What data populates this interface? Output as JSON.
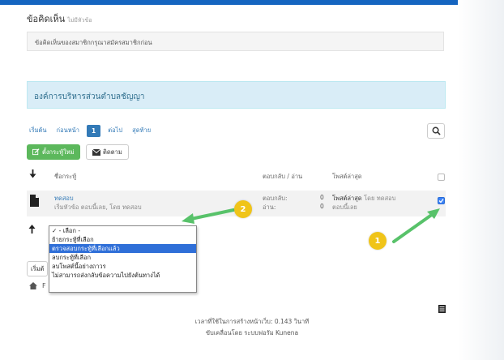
{
  "section": {
    "title": "ข้อคิดเห็น",
    "subtitle": "ไม่มีหัวข้อ"
  },
  "comment": {
    "text": "ข้อคิดเห็นของสมาชิกกรุณาสมัครสมาชิกก่อน"
  },
  "category": {
    "title": "องค์การบริหารส่วนตำบลชัญญา"
  },
  "pager": {
    "first": "เริ่มต้น",
    "prev": "ก่อนหน้า",
    "current": "1",
    "next": "ต่อไป",
    "last": "สุดท้าย"
  },
  "toolbar": {
    "new_topic": "ตั้งกระทู้ใหม่",
    "subscribe": "ติดตาม"
  },
  "table": {
    "col_subject": "ชื่อกระทู้",
    "col_replies": "ตอบกลับ / อ่าน",
    "col_last": "โพสต์ล่าสุด",
    "row": {
      "title": "ทดสอบ",
      "meta": "เริ่มหัวข้อ ตอบนี้เลย, โดย ทดสอบ",
      "replies_label": "ตอบกลับ:",
      "replies": "0",
      "views_label": "อ่าน:",
      "views": "0",
      "last_post_prefix": "โพสต์ล่าสุด",
      "last_post_by": "โดย ทดสอบ",
      "last_post_time": "ตอบนี้เลย",
      "checked": true
    }
  },
  "dropdown": {
    "options": [
      "✓ - เลือก -",
      "ย้ายกระทู้ที่เลือก",
      "ตรวจสอบกระทู้ที่เลือกแล้ว",
      "ลบกระทู้ที่เลือก",
      "ลบโพสต์นี้อย่างถาวร",
      "ไม่สามารถส่งกลับข้อความไปยังต้นทางได้"
    ],
    "selected_index": 2
  },
  "bottom": {
    "button_partial": "เริ่มต้",
    "breadcrumb_partial": "F"
  },
  "footer": {
    "time": "เวลาที่ใช้ในการสร้างหน้าเว็บ: 0.143 วินาที",
    "powered": "ขับเคลื่อนโดย ระบบฟอรัม Kunena"
  },
  "annotations": {
    "badge1": "1",
    "badge2": "2"
  },
  "colors": {
    "accent": "#337ab7",
    "success": "#5cb85c",
    "info_bg": "#d9edf7",
    "arrow": "#58c26a",
    "badge": "#f0c419"
  }
}
